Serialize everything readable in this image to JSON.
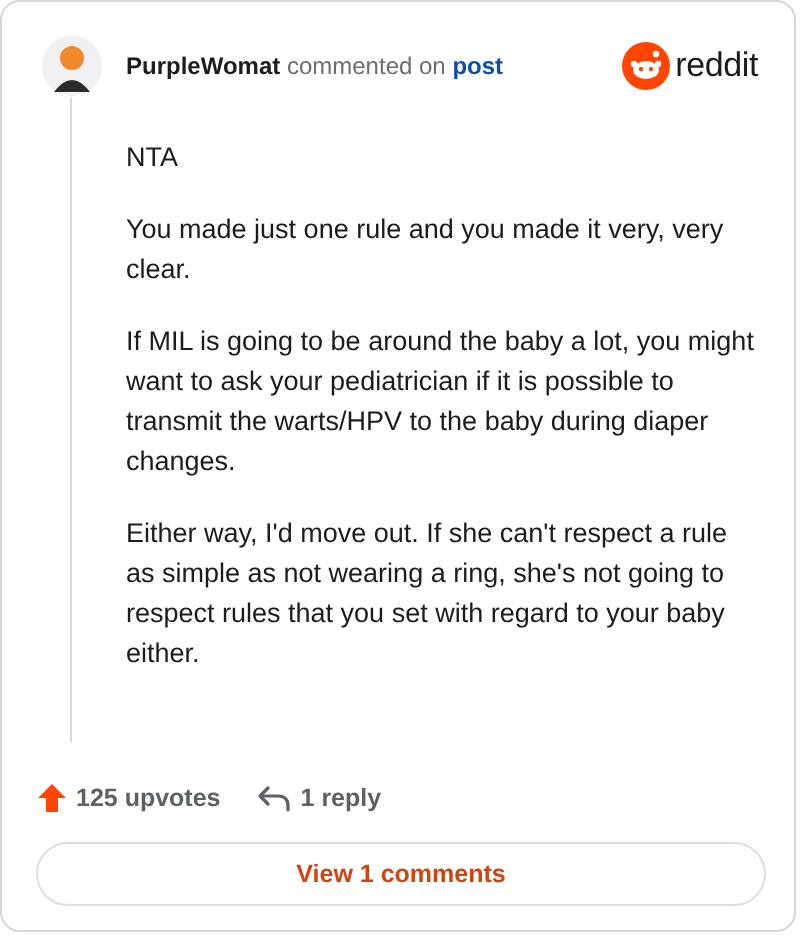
{
  "header": {
    "username": "PurpleWomat",
    "action": "commented on",
    "link": "post",
    "brand": "reddit"
  },
  "paragraphs": [
    "NTA",
    "You made just one rule and you made it very, very clear.",
    "If MIL is going to be around the baby a lot, you might want to ask your pediatrician if it is possible to transmit the warts/HPV to the baby during diaper changes.",
    "Either way, I'd move out. If she can't respect a rule as simple as not wearing a ring, she's not going to respect rules that you set with regard to your baby either."
  ],
  "footer": {
    "upvotes": "125 upvotes",
    "replies": "1 reply"
  },
  "button": "View 1 comments"
}
